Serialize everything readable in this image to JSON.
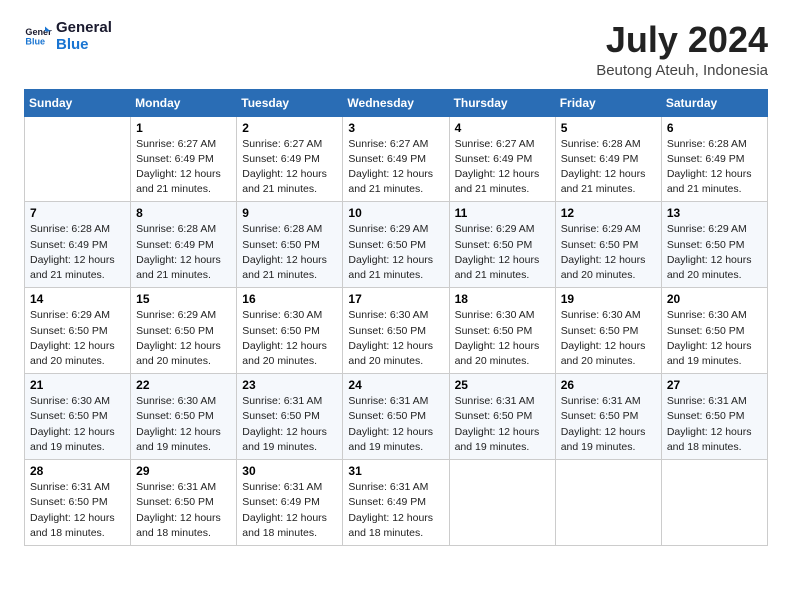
{
  "logo": {
    "line1": "General",
    "line2": "Blue"
  },
  "title": {
    "month_year": "July 2024",
    "location": "Beutong Ateuh, Indonesia"
  },
  "header": {
    "days": [
      "Sunday",
      "Monday",
      "Tuesday",
      "Wednesday",
      "Thursday",
      "Friday",
      "Saturday"
    ]
  },
  "weeks": [
    {
      "cells": [
        {
          "day": "",
          "info": ""
        },
        {
          "day": "1",
          "info": "Sunrise: 6:27 AM\nSunset: 6:49 PM\nDaylight: 12 hours\nand 21 minutes."
        },
        {
          "day": "2",
          "info": "Sunrise: 6:27 AM\nSunset: 6:49 PM\nDaylight: 12 hours\nand 21 minutes."
        },
        {
          "day": "3",
          "info": "Sunrise: 6:27 AM\nSunset: 6:49 PM\nDaylight: 12 hours\nand 21 minutes."
        },
        {
          "day": "4",
          "info": "Sunrise: 6:27 AM\nSunset: 6:49 PM\nDaylight: 12 hours\nand 21 minutes."
        },
        {
          "day": "5",
          "info": "Sunrise: 6:28 AM\nSunset: 6:49 PM\nDaylight: 12 hours\nand 21 minutes."
        },
        {
          "day": "6",
          "info": "Sunrise: 6:28 AM\nSunset: 6:49 PM\nDaylight: 12 hours\nand 21 minutes."
        }
      ]
    },
    {
      "cells": [
        {
          "day": "7",
          "info": "Sunrise: 6:28 AM\nSunset: 6:49 PM\nDaylight: 12 hours\nand 21 minutes."
        },
        {
          "day": "8",
          "info": "Sunrise: 6:28 AM\nSunset: 6:49 PM\nDaylight: 12 hours\nand 21 minutes."
        },
        {
          "day": "9",
          "info": "Sunrise: 6:28 AM\nSunset: 6:50 PM\nDaylight: 12 hours\nand 21 minutes."
        },
        {
          "day": "10",
          "info": "Sunrise: 6:29 AM\nSunset: 6:50 PM\nDaylight: 12 hours\nand 21 minutes."
        },
        {
          "day": "11",
          "info": "Sunrise: 6:29 AM\nSunset: 6:50 PM\nDaylight: 12 hours\nand 21 minutes."
        },
        {
          "day": "12",
          "info": "Sunrise: 6:29 AM\nSunset: 6:50 PM\nDaylight: 12 hours\nand 20 minutes."
        },
        {
          "day": "13",
          "info": "Sunrise: 6:29 AM\nSunset: 6:50 PM\nDaylight: 12 hours\nand 20 minutes."
        }
      ]
    },
    {
      "cells": [
        {
          "day": "14",
          "info": "Sunrise: 6:29 AM\nSunset: 6:50 PM\nDaylight: 12 hours\nand 20 minutes."
        },
        {
          "day": "15",
          "info": "Sunrise: 6:29 AM\nSunset: 6:50 PM\nDaylight: 12 hours\nand 20 minutes."
        },
        {
          "day": "16",
          "info": "Sunrise: 6:30 AM\nSunset: 6:50 PM\nDaylight: 12 hours\nand 20 minutes."
        },
        {
          "day": "17",
          "info": "Sunrise: 6:30 AM\nSunset: 6:50 PM\nDaylight: 12 hours\nand 20 minutes."
        },
        {
          "day": "18",
          "info": "Sunrise: 6:30 AM\nSunset: 6:50 PM\nDaylight: 12 hours\nand 20 minutes."
        },
        {
          "day": "19",
          "info": "Sunrise: 6:30 AM\nSunset: 6:50 PM\nDaylight: 12 hours\nand 20 minutes."
        },
        {
          "day": "20",
          "info": "Sunrise: 6:30 AM\nSunset: 6:50 PM\nDaylight: 12 hours\nand 19 minutes."
        }
      ]
    },
    {
      "cells": [
        {
          "day": "21",
          "info": "Sunrise: 6:30 AM\nSunset: 6:50 PM\nDaylight: 12 hours\nand 19 minutes."
        },
        {
          "day": "22",
          "info": "Sunrise: 6:30 AM\nSunset: 6:50 PM\nDaylight: 12 hours\nand 19 minutes."
        },
        {
          "day": "23",
          "info": "Sunrise: 6:31 AM\nSunset: 6:50 PM\nDaylight: 12 hours\nand 19 minutes."
        },
        {
          "day": "24",
          "info": "Sunrise: 6:31 AM\nSunset: 6:50 PM\nDaylight: 12 hours\nand 19 minutes."
        },
        {
          "day": "25",
          "info": "Sunrise: 6:31 AM\nSunset: 6:50 PM\nDaylight: 12 hours\nand 19 minutes."
        },
        {
          "day": "26",
          "info": "Sunrise: 6:31 AM\nSunset: 6:50 PM\nDaylight: 12 hours\nand 19 minutes."
        },
        {
          "day": "27",
          "info": "Sunrise: 6:31 AM\nSunset: 6:50 PM\nDaylight: 12 hours\nand 18 minutes."
        }
      ]
    },
    {
      "cells": [
        {
          "day": "28",
          "info": "Sunrise: 6:31 AM\nSunset: 6:50 PM\nDaylight: 12 hours\nand 18 minutes."
        },
        {
          "day": "29",
          "info": "Sunrise: 6:31 AM\nSunset: 6:50 PM\nDaylight: 12 hours\nand 18 minutes."
        },
        {
          "day": "30",
          "info": "Sunrise: 6:31 AM\nSunset: 6:49 PM\nDaylight: 12 hours\nand 18 minutes."
        },
        {
          "day": "31",
          "info": "Sunrise: 6:31 AM\nSunset: 6:49 PM\nDaylight: 12 hours\nand 18 minutes."
        },
        {
          "day": "",
          "info": ""
        },
        {
          "day": "",
          "info": ""
        },
        {
          "day": "",
          "info": ""
        }
      ]
    }
  ]
}
